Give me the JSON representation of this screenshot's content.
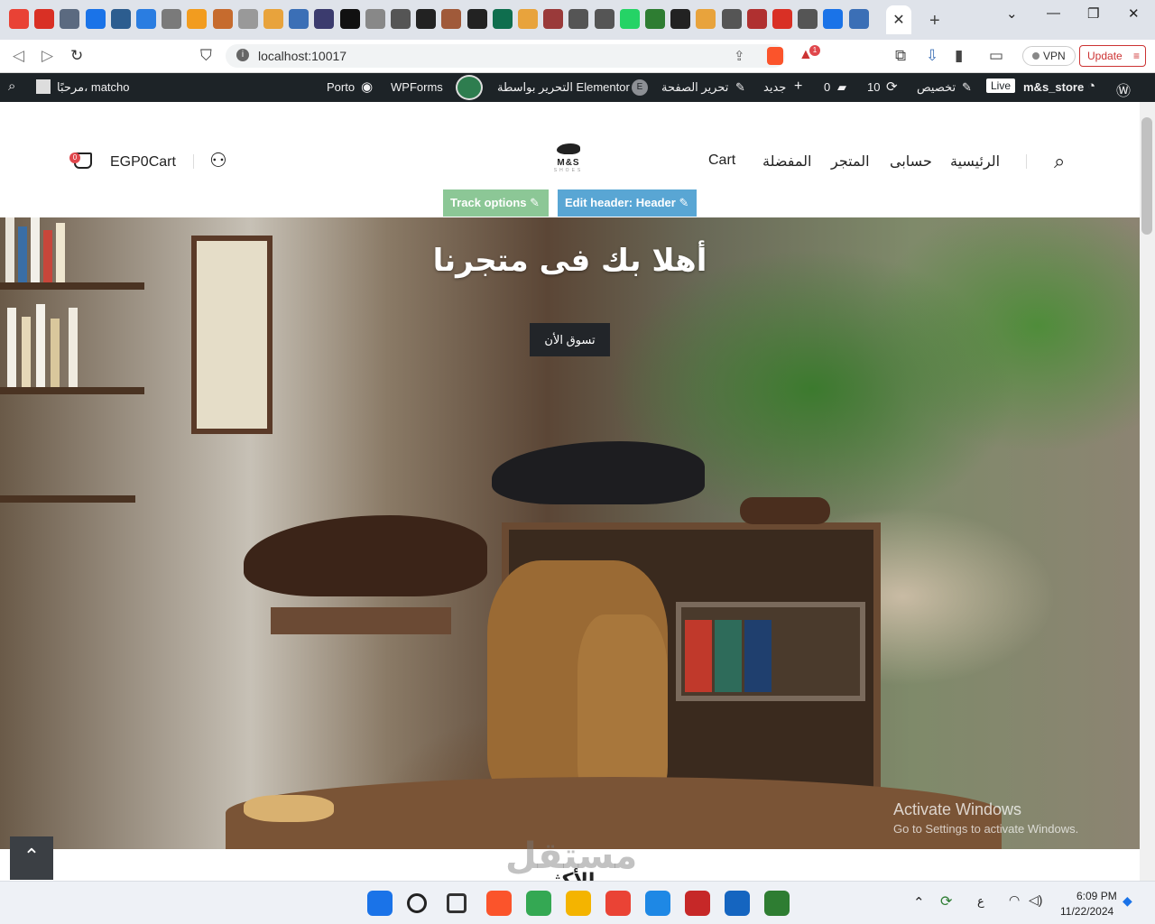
{
  "browser": {
    "url": "localhost:10017",
    "vpn_label": "VPN",
    "update_label": "Update",
    "notification_count": "1",
    "tab_favicons": [
      {
        "icon": "grid-icon",
        "color": "#e94235"
      },
      {
        "icon": "mail-icon",
        "color": "#d93025"
      },
      {
        "icon": "chat-icon",
        "color": "#5b6a80"
      },
      {
        "icon": "drop-icon",
        "color": "#1a73e8"
      },
      {
        "icon": "cloud-icon",
        "color": "#2c5d8f"
      },
      {
        "icon": "diamond-icon",
        "color": "#2a7de1"
      },
      {
        "icon": "text-icon",
        "color": "#7a7a7a"
      },
      {
        "icon": "infinity-icon",
        "color": "#f29c1f"
      },
      {
        "icon": "hat-icon",
        "color": "#c66b2e"
      },
      {
        "icon": "page-icon",
        "color": "#999999"
      },
      {
        "icon": "flag-icon",
        "color": "#e8a33c"
      },
      {
        "icon": "doc-icon",
        "color": "#3b6fb6"
      },
      {
        "icon": "image-icon",
        "color": "#3b3b6e"
      },
      {
        "icon": "notion-icon",
        "color": "#111111"
      },
      {
        "icon": "cart-icon",
        "color": "#888888"
      },
      {
        "icon": "globe-icon",
        "color": "#555555"
      },
      {
        "icon": "wave-icon",
        "color": "#222222"
      },
      {
        "icon": "photo-icon",
        "color": "#a05a3a"
      },
      {
        "icon": "check-icon",
        "color": "#222222"
      },
      {
        "icon": "phone-icon",
        "color": "#0f6e4e"
      },
      {
        "icon": "app-icon",
        "color": "#e8a33c"
      },
      {
        "icon": "logo-icon",
        "color": "#9a3a3a"
      },
      {
        "icon": "glasses-icon",
        "color": "#555555"
      },
      {
        "icon": "dash-icon",
        "color": "#555555"
      },
      {
        "icon": "whatsapp-icon",
        "color": "#25d366"
      },
      {
        "icon": "leaf-icon",
        "color": "#2e7d32"
      },
      {
        "icon": "amazon-icon",
        "color": "#222222"
      },
      {
        "icon": "logo-icon",
        "color": "#e8a33c"
      },
      {
        "icon": "rocket-icon",
        "color": "#555555"
      },
      {
        "icon": "badge-icon",
        "color": "#b03030"
      },
      {
        "icon": "gmail-icon",
        "color": "#d93025"
      },
      {
        "icon": "dash-icon",
        "color": "#555555"
      },
      {
        "icon": "drive-icon",
        "color": "#1a73e8"
      },
      {
        "icon": "page-icon",
        "color": "#3b6fb6"
      }
    ]
  },
  "wp_admin": {
    "site_name": "m&s_store",
    "live": "Live",
    "customize": "تخصيص",
    "updates_count": "10",
    "comments_count": "0",
    "new_label": "جديد",
    "edit_page": "تحرير الصفحة",
    "edit_elementor": "التحرير بواسطة Elementor",
    "wpforms": "WPForms",
    "porto": "Porto",
    "greeting": "مرحبًا، matcho"
  },
  "header": {
    "logo_text": "M&S",
    "logo_sub": "SHOES",
    "menu": [
      {
        "label": "الرئيسية",
        "name": "menu-item-home"
      },
      {
        "label": "حسابى",
        "name": "menu-item-account"
      },
      {
        "label": "المتجر",
        "name": "menu-item-shop"
      },
      {
        "label": "المفضلة",
        "name": "menu-item-wishlist"
      },
      {
        "label": "Cart",
        "name": "menu-item-cart"
      }
    ],
    "cart_label": "EGP0Cart",
    "cart_count": "0",
    "track_options": "Track options",
    "edit_header": "Edit header: Header"
  },
  "hero": {
    "title": "أهلا بك فى متجرنا",
    "shop_button": "تسوق الأن"
  },
  "watermark": {
    "title": "Activate Windows",
    "subtitle": "Go to Settings to activate Windows."
  },
  "section": {
    "heading": "الأكثر"
  },
  "overlay_brand": "مستقل",
  "taskbar": {
    "time": "6:09 PM",
    "date": "11/22/2024",
    "lang": "ع",
    "apps": [
      {
        "name": "windows-start-icon",
        "color": "#1a73e8"
      },
      {
        "name": "search-icon",
        "color": "#222222"
      },
      {
        "name": "task-view-icon",
        "color": "#333333"
      },
      {
        "name": "brave-icon",
        "color": "#fb542b"
      },
      {
        "name": "chrome-icon",
        "color": "#34a853"
      },
      {
        "name": "file-explorer-icon",
        "color": "#f4b400"
      },
      {
        "name": "chrome-icon",
        "color": "#ea4335"
      },
      {
        "name": "vscode-icon",
        "color": "#1e88e5"
      },
      {
        "name": "app-icon",
        "color": "#c62828"
      },
      {
        "name": "cursor-app-icon",
        "color": "#1565c0"
      },
      {
        "name": "git-icon",
        "color": "#2e7d32"
      }
    ]
  }
}
